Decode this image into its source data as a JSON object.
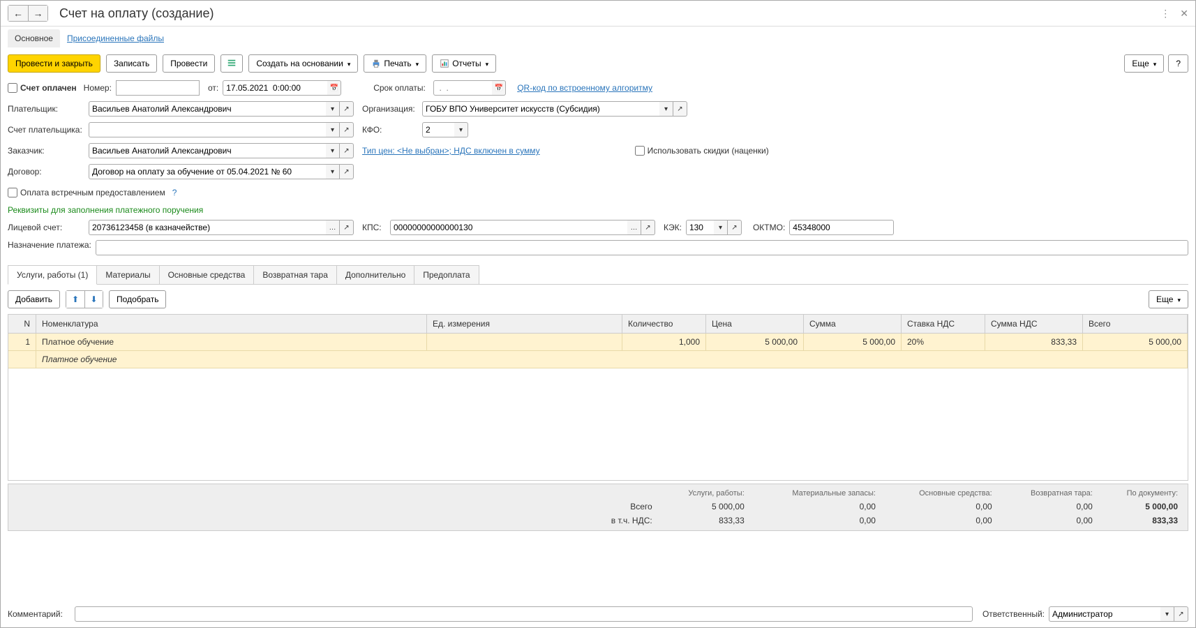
{
  "title": "Счет на оплату (создание)",
  "navTabs": {
    "main": "Основное",
    "attached": "Присоединенные файлы"
  },
  "toolbar": {
    "postClose": "Провести и закрыть",
    "save": "Записать",
    "post": "Провести",
    "createBased": "Создать на основании",
    "print": "Печать",
    "reports": "Отчеты",
    "more": "Еще",
    "help": "?"
  },
  "fields": {
    "paidLabel": "Счет оплачен",
    "numberLabel": "Номер:",
    "numberValue": "",
    "fromLabel": "от:",
    "dateValue": "17.05.2021  0:00:00",
    "dueLabel": "Срок оплаты:",
    "duePlaceholder": " .  .",
    "qrLink": "QR-код по встроенному алгоритму",
    "payerLabel": "Плательщик:",
    "payerValue": "Васильев Анатолий Александрович",
    "orgLabel": "Организация:",
    "orgValue": "ГОБУ ВПО Университет искусств (Субсидия)",
    "payerAccLabel": "Счет плательщика:",
    "payerAccValue": "",
    "kfoLabel": "КФО:",
    "kfoValue": "2",
    "customerLabel": "Заказчик:",
    "customerValue": "Васильев Анатолий Александрович",
    "priceTypeLink": "Тип цен: <Не выбран>; НДС включен в сумму",
    "discountsLabel": "Использовать скидки (наценки)",
    "contractLabel": "Договор:",
    "contractValue": "Договор на оплату за обучение от 05.04.2021 № 60",
    "counterPayLabel": "Оплата встречным предоставлением",
    "requisitesHeader": "Реквизиты для заполнения платежного поручения",
    "licAccLabel": "Лицевой счет:",
    "licAccValue": "20736123458 (в казначействе)",
    "kpsLabel": "КПС:",
    "kpsValue": "00000000000000130",
    "kekLabel": "КЭК:",
    "kekValue": "130",
    "oktmoLabel": "ОКТМО:",
    "oktmoValue": "45348000",
    "purposeLabel": "Назначение платежа:",
    "purposeValue": ""
  },
  "tabs": {
    "services": "Услуги, работы (1)",
    "materials": "Материалы",
    "fixedAssets": "Основные средства",
    "packaging": "Возвратная тара",
    "extra": "Дополнительно",
    "prepay": "Предоплата"
  },
  "tabToolbar": {
    "add": "Добавить",
    "pick": "Подобрать",
    "more": "Еще"
  },
  "gridHeaders": {
    "n": "N",
    "nomencl": "Номенклатура",
    "unit": "Ед. измерения",
    "qty": "Количество",
    "price": "Цена",
    "sum": "Сумма",
    "vatRate": "Ставка НДС",
    "vatSum": "Сумма НДС",
    "total": "Всего"
  },
  "gridRows": [
    {
      "n": "1",
      "nomencl": "Платное обучение",
      "nomencl2": "Платное обучение",
      "unit": "",
      "qty": "1,000",
      "price": "5 000,00",
      "sum": "5 000,00",
      "vatRate": "20%",
      "vatSum": "833,33",
      "total": "5 000,00"
    }
  ],
  "totals": {
    "hdr": {
      "services": "Услуги, работы:",
      "materials": "Материальные запасы:",
      "fixed": "Основные средства:",
      "packaging": "Возвратная тара:",
      "doc": "По документу:"
    },
    "rowTotal": {
      "label": "Всего",
      "services": "5 000,00",
      "materials": "0,00",
      "fixed": "0,00",
      "packaging": "0,00",
      "doc": "5 000,00"
    },
    "rowVat": {
      "label": "в т.ч. НДС:",
      "services": "833,33",
      "materials": "0,00",
      "fixed": "0,00",
      "packaging": "0,00",
      "doc": "833,33"
    }
  },
  "footer": {
    "commentLabel": "Комментарий:",
    "commentValue": "",
    "respLabel": "Ответственный:",
    "respValue": "Администратор"
  }
}
